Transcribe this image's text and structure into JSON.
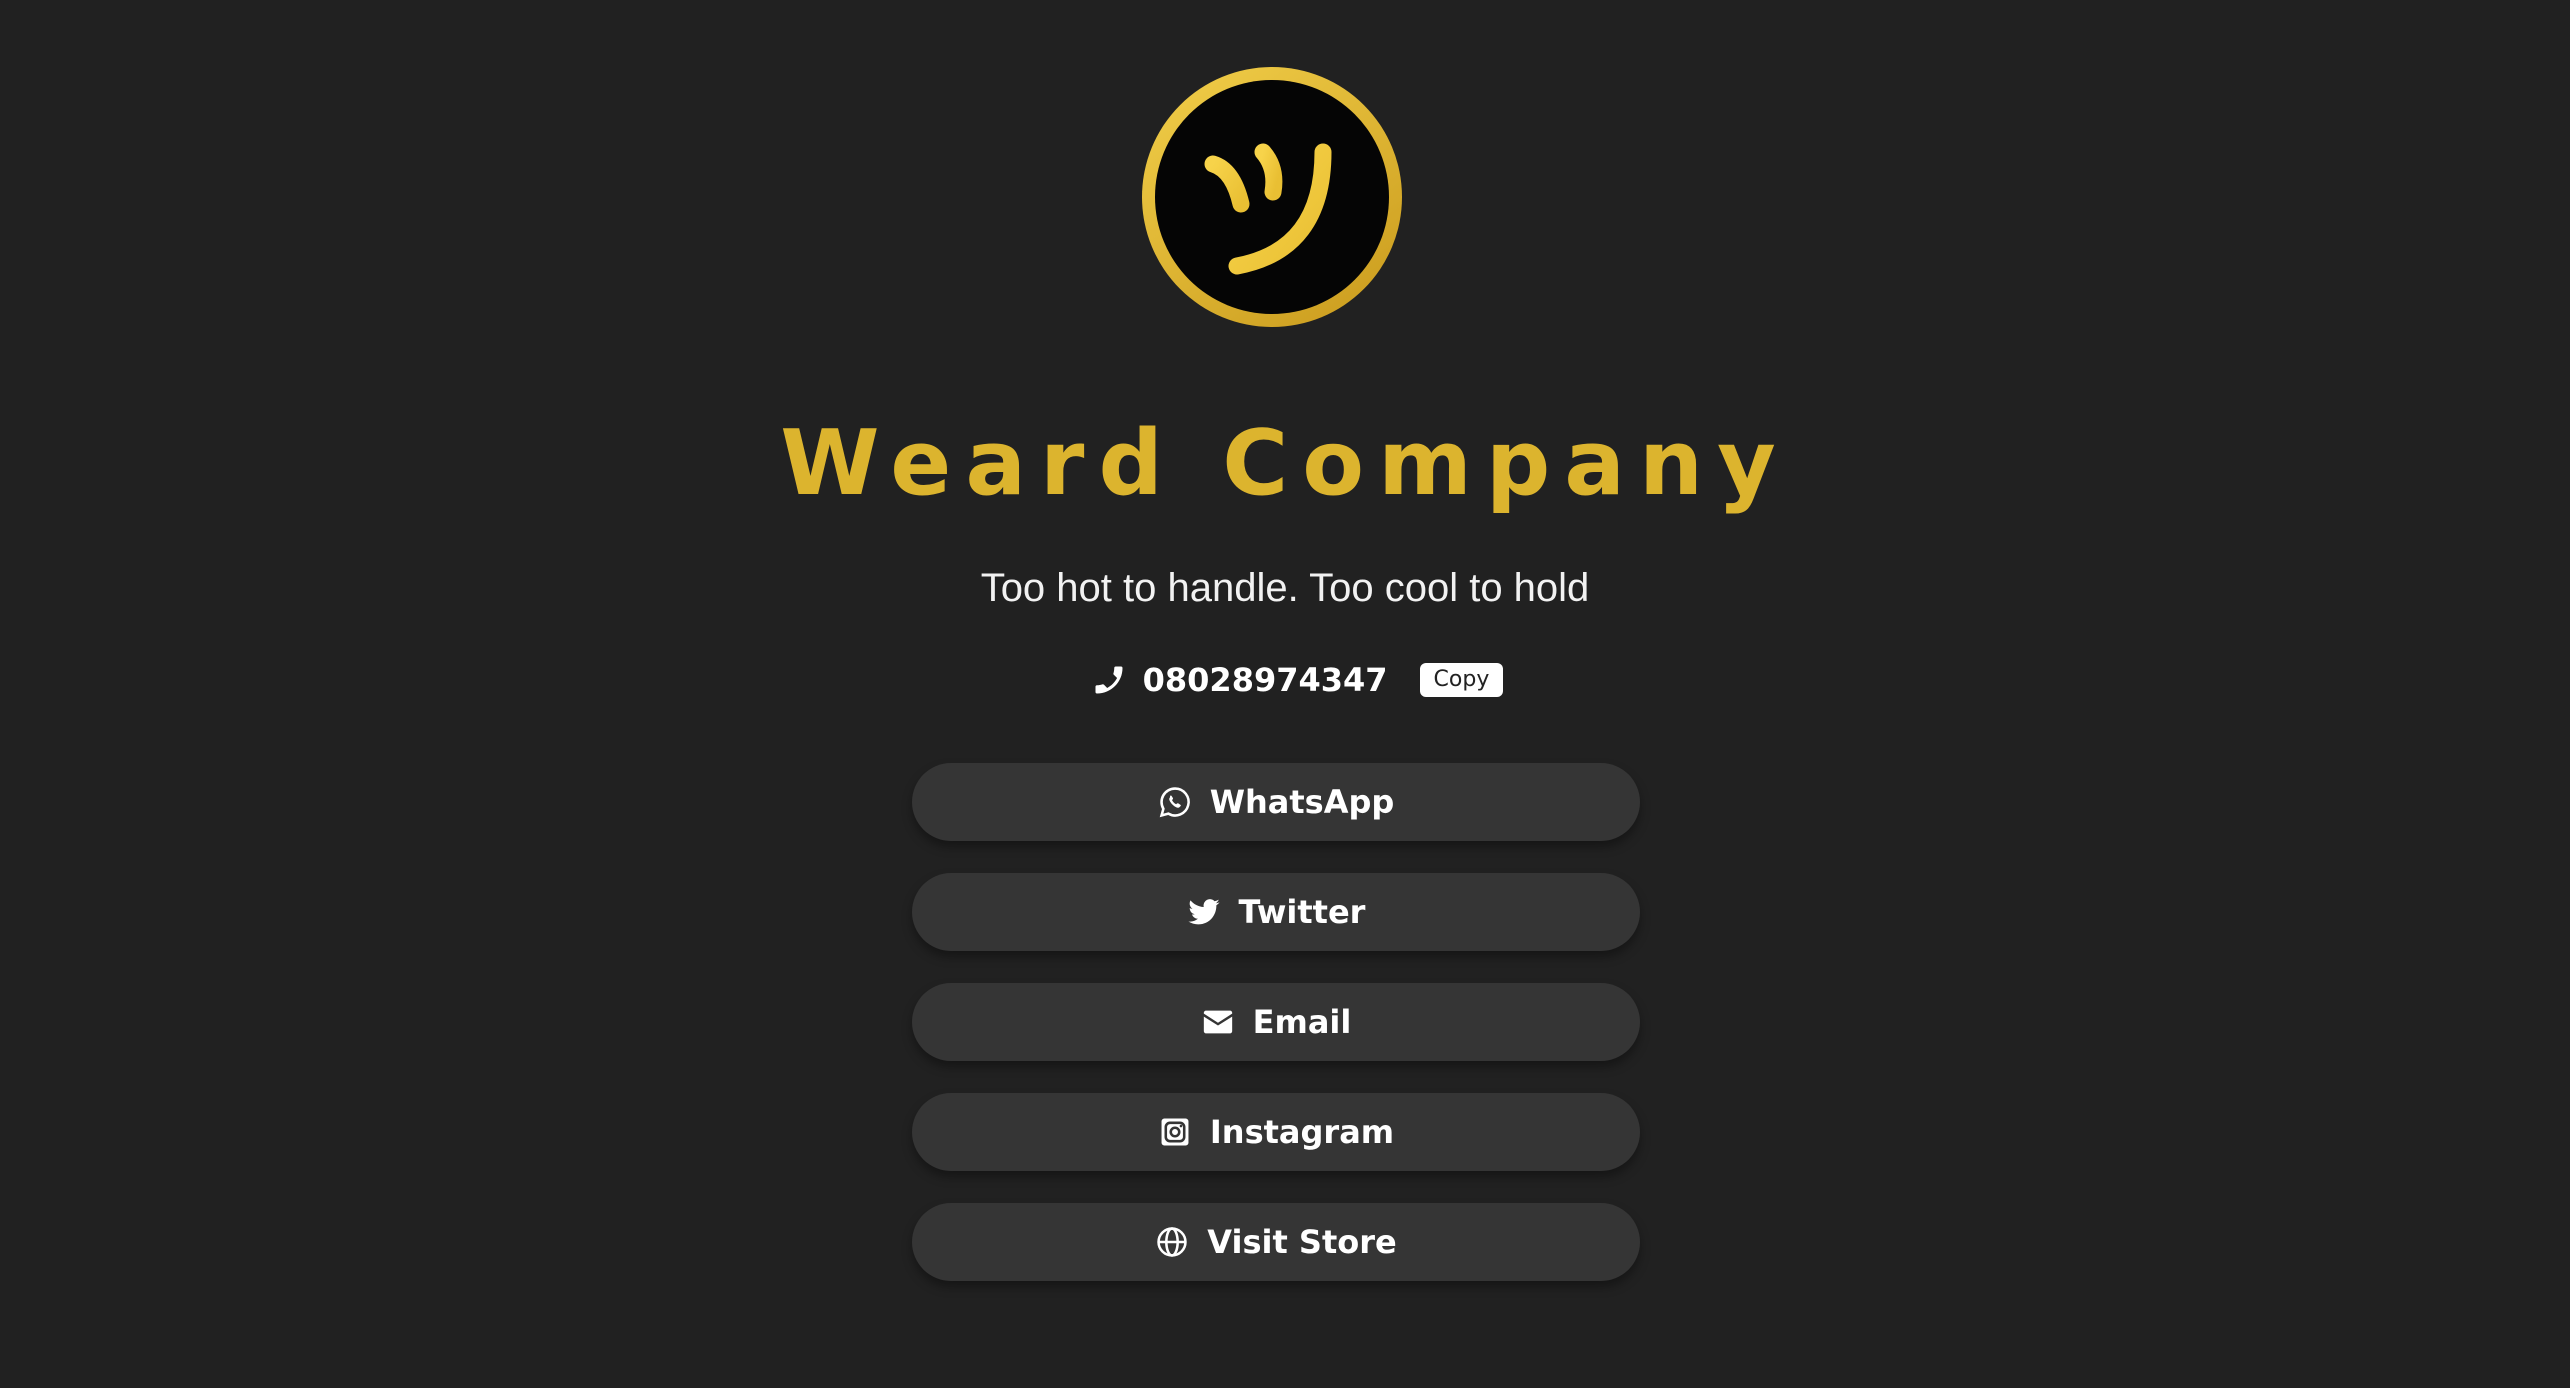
{
  "brand": {
    "name": "Weard Company",
    "tagline": "Too hot to handle. Too cool to hold",
    "logo_icon": "smiley-tsu-logo"
  },
  "contact": {
    "phone_icon": "phone-icon",
    "phone_number": "08028974347",
    "copy_label": "Copy"
  },
  "links": [
    {
      "label": "WhatsApp",
      "icon": "whatsapp-icon"
    },
    {
      "label": "Twitter",
      "icon": "twitter-icon"
    },
    {
      "label": "Email",
      "icon": "envelope-icon"
    },
    {
      "label": "Instagram",
      "icon": "instagram-icon"
    },
    {
      "label": "Visit Store",
      "icon": "globe-icon"
    }
  ],
  "colors": {
    "background": "#212121",
    "accent_gold": "#dcb42e",
    "button_bg": "#353535"
  }
}
